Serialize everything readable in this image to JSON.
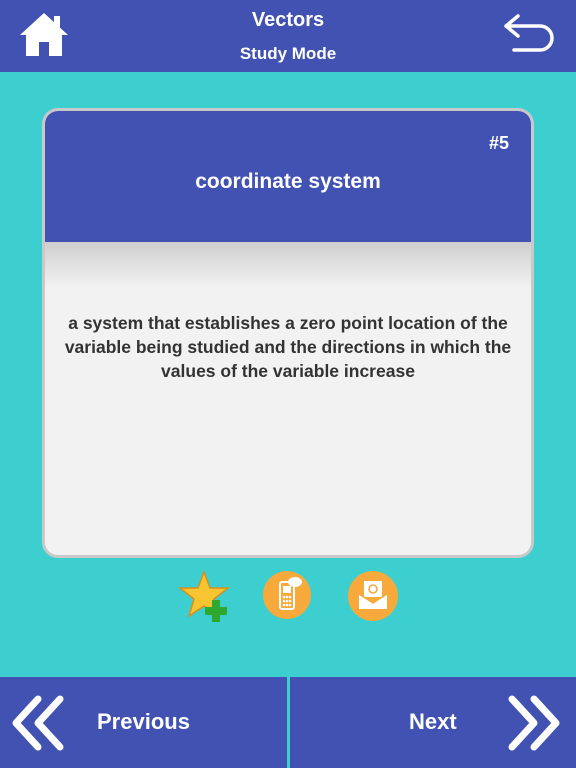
{
  "header": {
    "title": "Vectors",
    "subtitle": "Study Mode",
    "home_icon": "home-icon",
    "back_icon": "return-arrow-icon"
  },
  "card": {
    "number": "#5",
    "term": "coordinate system",
    "definition": "a system that establishes a zero point location of the variable being studied and the directions in which the values of the variable increase"
  },
  "actions": {
    "favorite_icon": "star-add-icon",
    "sms_icon": "sms-phone-icon",
    "email_icon": "email-envelope-icon"
  },
  "footer": {
    "previous_label": "Previous",
    "next_label": "Next"
  },
  "colors": {
    "primary": "#4152b3",
    "background": "#3dcfcf",
    "card": "#f2f2f2",
    "accent": "#f7a93b"
  }
}
